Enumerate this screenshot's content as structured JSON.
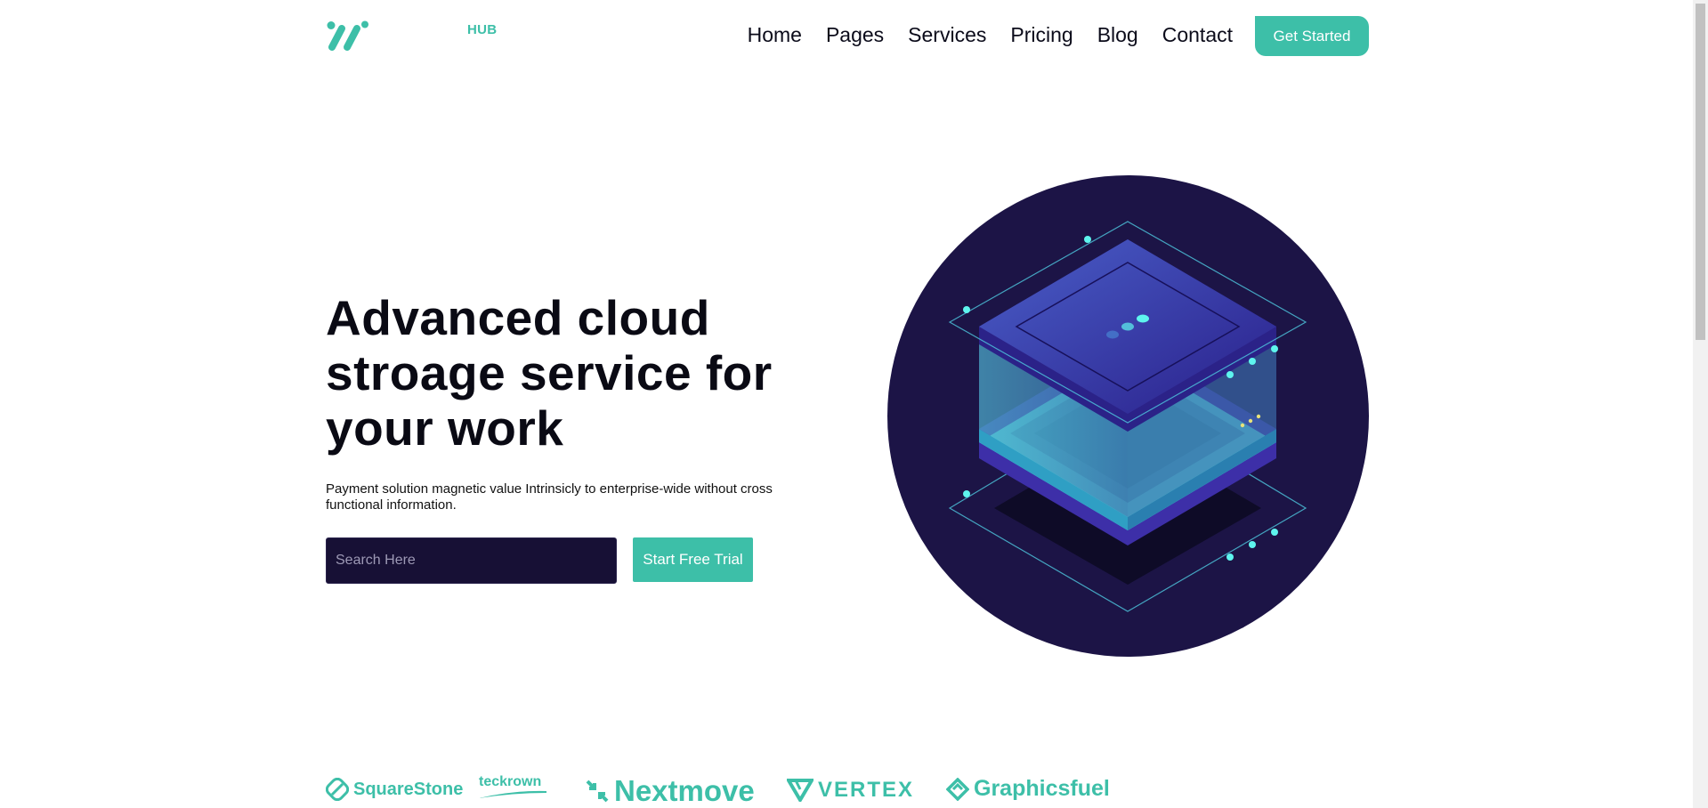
{
  "header": {
    "logo_label": "HUB",
    "nav": [
      "Home",
      "Pages",
      "Services",
      "Pricing",
      "Blog",
      "Contact"
    ],
    "cta_label": "Get Started"
  },
  "hero": {
    "title": "Advanced cloud stroage service for your work",
    "description": "Payment solution magnetic value Intrinsicly to enterprise-wide without cross functional information.",
    "search_placeholder": "Search Here",
    "trial_label": "Start Free Trial"
  },
  "brands": [
    "SquareStone",
    "teckrown",
    "Nextmove",
    "VERTEX",
    "Graphicsfuel"
  ],
  "colors": {
    "accent": "#3dbfa8",
    "dark_navy": "#1c1446",
    "cyan": "#5ef5ee"
  },
  "icons": {
    "logo": "slash-marks-logo",
    "illustration": "cloud-storage-server-isometric"
  }
}
